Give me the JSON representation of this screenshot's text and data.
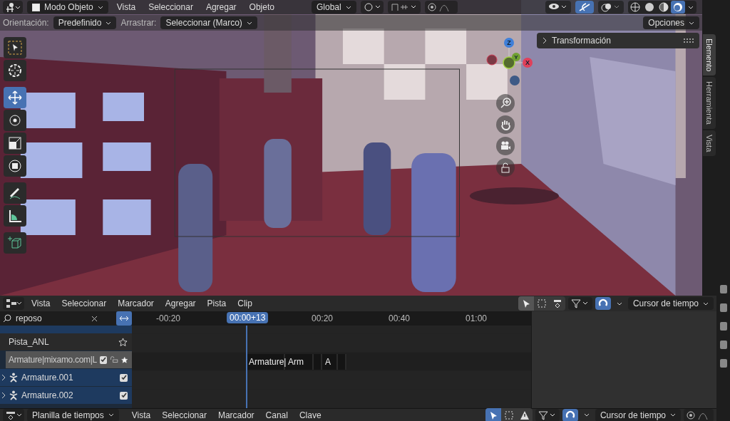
{
  "viewport_header": {
    "mode": "Modo Objeto",
    "menu": [
      "Vista",
      "Seleccionar",
      "Agregar",
      "Objeto"
    ],
    "orientation": "Global",
    "shading": [
      {
        "kind": "wire",
        "selected": false
      },
      {
        "kind": "solid",
        "selected": false
      },
      {
        "kind": "material",
        "selected": false
      },
      {
        "kind": "rendered",
        "selected": true
      }
    ]
  },
  "tool_settings": {
    "orientation_label": "Orientación:",
    "orientation": "Predefinido",
    "drag_label": "Arrastrar:",
    "drag": "Seleccionar (Marco)",
    "options": "Opciones"
  },
  "toolbar": [
    {
      "kind": "select",
      "selected": false
    },
    {
      "kind": "cursor",
      "selected": false
    },
    {
      "kind": "move",
      "selected": true
    },
    {
      "kind": "rotate",
      "selected": false
    },
    {
      "kind": "scale",
      "selected": false
    },
    {
      "kind": "transform",
      "selected": false
    },
    {
      "kind": "annotate",
      "selected": false
    },
    {
      "kind": "measure",
      "selected": false
    },
    {
      "kind": "add",
      "selected": false
    }
  ],
  "gizmo": {
    "z": "Z",
    "y": "Y",
    "x": "X"
  },
  "sidebar": {
    "panel": "Transformación",
    "expanded": false,
    "tabs": [
      {
        "label": "Elemento",
        "selected": true
      },
      {
        "label": "Herramienta",
        "selected": false
      },
      {
        "label": "Vista",
        "selected": false
      }
    ]
  },
  "nla": {
    "menu": [
      "Vista",
      "Seleccionar",
      "Marcador",
      "Agregar",
      "Pista",
      "Clip"
    ],
    "search": "reposo",
    "current_frame": "00:00+13",
    "ticks": [
      "-00:20",
      "00:20",
      "00:40",
      "01:00"
    ],
    "pivot": "Cursor de tiempo",
    "channels": [
      {
        "kind": "track",
        "name": "Pista_ANL",
        "starred": false
      },
      {
        "kind": "action",
        "name": "Armature|mixamo.com|L",
        "checked": true,
        "starred": true
      },
      {
        "kind": "object",
        "name": "Armature.001",
        "checked": true
      },
      {
        "kind": "object",
        "name": "Armature.002",
        "checked": true
      }
    ],
    "strips": [
      {
        "kind": "labeled",
        "label": "Armature|"
      },
      {
        "kind": "labeled",
        "label": "Arm"
      },
      {
        "kind": "blank"
      },
      {
        "kind": "labeled",
        "label": "A"
      },
      {
        "kind": "blank"
      }
    ]
  },
  "timeline": {
    "editor": "Planilla de tiempos",
    "menu": [
      "Vista",
      "Seleccionar",
      "Marcador",
      "Canal",
      "Clave"
    ],
    "pivot": "Cursor de tiempo"
  }
}
